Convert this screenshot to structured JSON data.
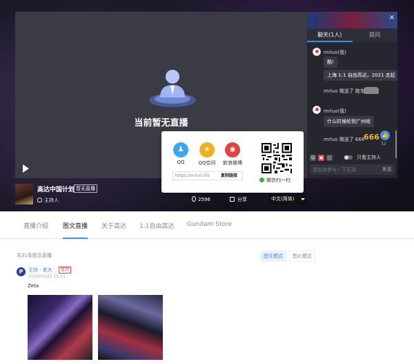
{
  "player": {
    "no_live_text": "当前暂无直播"
  },
  "chat": {
    "banner_text": "",
    "tabs": [
      "聊天(1人)",
      "提问"
    ],
    "messages": [
      {
        "user": "mrluo(我)",
        "text": "酷!"
      },
      {
        "text": "上海 1:1 自由高达，2021 走起"
      },
      {
        "gift": "mrluo 赠送了 跑车"
      },
      {
        "user": "mrluo(我)",
        "text": "什么时候轮到广州呢"
      },
      {
        "gift": "mrluo 赠送了 666"
      }
    ],
    "big_666": "666",
    "like_count": "32",
    "only_host_label": "只看主持人",
    "input_placeholder": "我也来参与一下互动",
    "send_label": "发送",
    "close_icon": "×"
  },
  "host": {
    "title": "高达中国计划",
    "badge": "暂无直播",
    "label": "主持人",
    "view_count": "2596",
    "share_label": "分享",
    "language": "中文(简体)"
  },
  "share_popup": {
    "items": [
      {
        "label": "QQ",
        "color": "#3aa8f0"
      },
      {
        "label": "QQ空间",
        "color": "#f0b020"
      },
      {
        "label": "新浪微博",
        "color": "#e0443e"
      }
    ],
    "link_url": "https://mrluo.life",
    "copy_label": "复制链接",
    "qr_label": "微信扫一扫"
  },
  "nav": {
    "tabs": [
      "直播介绍",
      "图文直播",
      "关于高达",
      "1:1自由高达",
      "Gundam Store"
    ],
    "active_index": 1
  },
  "feed": {
    "total": "共31条图文直播",
    "modes": [
      "图文模式",
      "图片模式"
    ],
    "post": {
      "avatar_letter": "P",
      "author": "主持 · 老大",
      "badge": "置顶",
      "time": "2020/03/25 15:33",
      "text": "Zeta"
    }
  },
  "colors": {
    "accent": "#3a8ef0",
    "danger": "#e0443e",
    "chat_bg": "#26262e",
    "player_bg": "#3a3b45"
  }
}
